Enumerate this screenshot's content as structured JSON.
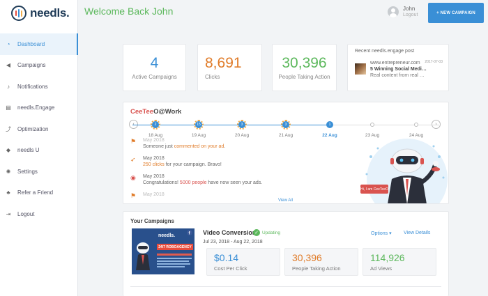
{
  "brand": {
    "name": "needls."
  },
  "sidebar": {
    "items": [
      {
        "label": "Dashboard",
        "icon": "dashboard-icon",
        "glyph": "◔",
        "active": true
      },
      {
        "label": "Campaigns",
        "icon": "megaphone-icon",
        "glyph": "◀"
      },
      {
        "label": "Notifications",
        "icon": "bell-icon",
        "glyph": "♪"
      },
      {
        "label": "needls.Engage",
        "icon": "document-icon",
        "glyph": "▤"
      },
      {
        "label": "Optimization",
        "icon": "trend-icon",
        "glyph": "⤴"
      },
      {
        "label": "needls U",
        "icon": "graduation-cap-icon",
        "glyph": "◆"
      },
      {
        "label": "Settings",
        "icon": "gear-icon",
        "glyph": "✺"
      },
      {
        "label": "Refer a Friend",
        "icon": "users-icon",
        "glyph": "♣"
      },
      {
        "label": "Logout",
        "icon": "logout-icon",
        "glyph": "⇥"
      }
    ]
  },
  "header": {
    "welcome": "Welcome Back John",
    "user_name": "John",
    "logout": "Logout",
    "new_campaign": "+ NEW CAMPAIGN"
  },
  "stats": [
    {
      "value": "4",
      "label": "Active Campaigns",
      "color": "#3a8fd6"
    },
    {
      "value": "8,691",
      "label": "Clicks",
      "color": "#e07b28"
    },
    {
      "value": "30,396",
      "label": "People Taking Action",
      "color": "#5cb85c"
    }
  ],
  "recent_post": {
    "title": "Recent needls.engage post",
    "date": "2017-07-03",
    "site": "www.entrepreneur.com",
    "headline": "5 Winning Social Medi…",
    "excerpt": "Real content from real …"
  },
  "timeline": {
    "brand_red": "CeeTee",
    "brand_dark": "O@Work",
    "dates": [
      "18 Aug",
      "19 Aug",
      "20 Aug",
      "21 Aug",
      "22 Aug",
      "23 Aug",
      "24 Aug"
    ],
    "node_labels": [
      "2",
      "15",
      "3",
      "3",
      "1",
      "",
      ""
    ],
    "current_index": 4,
    "events": [
      {
        "title": "May 2018",
        "pre": "Someone just ",
        "hl": "commented on your ad",
        "post": ".",
        "icon": "flag-icon",
        "glyph": "⚑",
        "hl_color": "orange"
      },
      {
        "title": "May 2018",
        "pre": "",
        "hl": "250 clicks",
        "post": " for your campaign. Bravo!",
        "icon": "cursor-click-icon",
        "glyph": "➶",
        "hl_color": "orange"
      },
      {
        "title": "May 2018",
        "pre": "Congratulations! ",
        "hl": "5000 people",
        "post": " have now seen your ads.",
        "icon": "eye-icon",
        "glyph": "◉",
        "hl_color": "red"
      },
      {
        "title": "May 2018",
        "pre": "",
        "hl": "",
        "post": "",
        "icon": "flag-icon",
        "glyph": "⚑",
        "hl_color": "orange"
      }
    ],
    "view_all": "View All",
    "robot_bubble": "Hi, I am CeeTeeO"
  },
  "campaigns": {
    "title": "Your Campaigns",
    "name": "Video Conversions",
    "status": "Updating",
    "dates": "Jul 23, 2018 - Aug 22, 2018",
    "options": "Options ▾",
    "view_details": "View Details",
    "image_text": "24/7 ROBOAGENCY",
    "metrics": [
      {
        "value": "$0.14",
        "label": "Cost Per Click",
        "color": "#3a8fd6"
      },
      {
        "value": "30,396",
        "label": "People Taking Action",
        "color": "#e07b28"
      },
      {
        "value": "114,926",
        "label": "Ad Views",
        "color": "#5cb85c"
      }
    ]
  }
}
